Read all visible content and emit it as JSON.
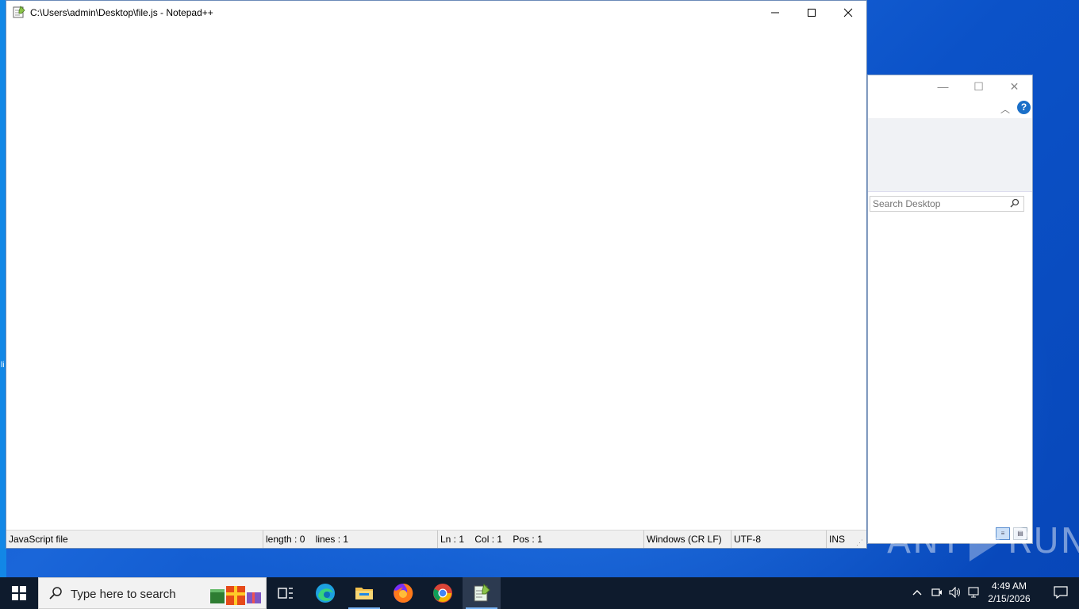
{
  "notepad": {
    "title": "C:\\Users\\admin\\Desktop\\file.js - Notepad++",
    "status": {
      "file_type": "JavaScript file",
      "length": "length : 0",
      "lines": "lines : 1",
      "ln": "Ln : 1",
      "col": "Col : 1",
      "pos": "Pos : 1",
      "eol": "Windows (CR LF)",
      "encoding": "UTF-8",
      "mode": "INS"
    }
  },
  "explorer": {
    "search_placeholder": "Search Desktop",
    "help": "?"
  },
  "desktop": {
    "edge_char": "li"
  },
  "taskbar": {
    "search_placeholder": "Type here to search",
    "apps": [
      "task-view",
      "edge",
      "file-explorer",
      "firefox",
      "chrome",
      "notepad++"
    ],
    "clock_time": "4:49 AM",
    "clock_date": "2/15/2026"
  },
  "watermark": {
    "left": "ANY",
    "right": "RUN"
  },
  "colors": {
    "taskbar": "#0e1b2d",
    "desktop": "#0b52c8",
    "accent": "#78b4f5"
  }
}
